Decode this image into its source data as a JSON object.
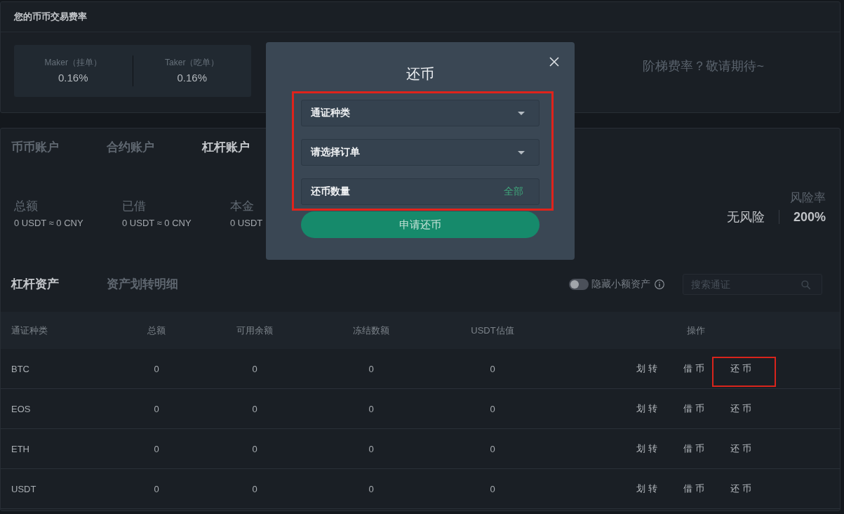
{
  "fee_panel": {
    "title": "您的币币交易费率",
    "rates": [
      {
        "label": "Maker（挂单）",
        "value": "0.16%"
      },
      {
        "label": "Taker（吃单）",
        "value": "0.16%"
      }
    ],
    "note": "阶梯费率？敬请期待~"
  },
  "account_tabs": [
    {
      "label": "币币账户",
      "selected": false
    },
    {
      "label": "合约账户",
      "selected": false
    },
    {
      "label": "杠杆账户",
      "selected": true
    }
  ],
  "summary": {
    "stats": [
      {
        "label": "总额",
        "value": "0 USDT ≈ 0 CNY"
      },
      {
        "label": "已借",
        "value": "0 USDT ≈ 0 CNY"
      },
      {
        "label": "本金",
        "value": "0 USDT"
      }
    ],
    "risk": {
      "label": "风险率",
      "status": "无风险",
      "value": "200%"
    }
  },
  "asset_tabs": [
    {
      "label": "杠杆资产",
      "selected": true
    },
    {
      "label": "资产划转明细",
      "selected": false
    }
  ],
  "hide_small_assets": {
    "label": "隐藏小额资产",
    "on": false
  },
  "search": {
    "placeholder": "搜索通证"
  },
  "table": {
    "columns": [
      "通证种类",
      "总额",
      "可用余额",
      "冻结数额",
      "USDT估值",
      "操作"
    ],
    "rows": [
      {
        "cells": [
          "BTC",
          "0",
          "0",
          "0",
          "0"
        ],
        "actions": [
          {
            "label": "划转",
            "highlighted": false
          },
          {
            "label": "借币",
            "highlighted": false
          },
          {
            "label": "还币",
            "highlighted": true
          }
        ]
      },
      {
        "cells": [
          "EOS",
          "0",
          "0",
          "0",
          "0"
        ],
        "actions": [
          {
            "label": "划转",
            "highlighted": false
          },
          {
            "label": "借币",
            "highlighted": false
          },
          {
            "label": "还币",
            "highlighted": false
          }
        ]
      },
      {
        "cells": [
          "ETH",
          "0",
          "0",
          "0",
          "0"
        ],
        "actions": [
          {
            "label": "划转",
            "highlighted": false
          },
          {
            "label": "借币",
            "highlighted": false
          },
          {
            "label": "还币",
            "highlighted": false
          }
        ]
      },
      {
        "cells": [
          "USDT",
          "0",
          "0",
          "0",
          "0"
        ],
        "actions": [
          {
            "label": "划转",
            "highlighted": false
          },
          {
            "label": "借币",
            "highlighted": false
          },
          {
            "label": "还币",
            "highlighted": false
          }
        ]
      }
    ]
  },
  "modal": {
    "title": "还币",
    "fields_highlighted": true,
    "fields": [
      {
        "kind": "select",
        "label": "通证种类"
      },
      {
        "kind": "select",
        "label": "请选择订单"
      },
      {
        "kind": "amount",
        "label": "还币数量",
        "action": "全部"
      }
    ],
    "submit": "申请还币"
  }
}
